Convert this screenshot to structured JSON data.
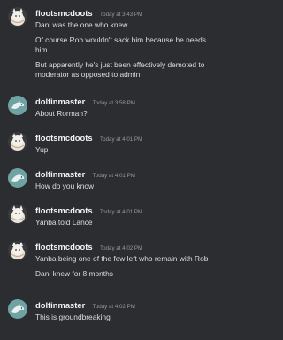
{
  "messages": [
    {
      "author": "flootsmcdoots",
      "avatar": "cat-avatar",
      "timestamp": "Today at 3:43 PM",
      "lines": [
        "Dani was the one who knew",
        "Of course Rob wouldn't sack him because he needs him",
        "But apparently he's just been effectively demoted to moderator as opposed to admin"
      ]
    },
    {
      "author": "dolfinmaster",
      "avatar": "dolphin-avatar",
      "timestamp": "Today at 3:58 PM",
      "lines": [
        "About Rorman?"
      ]
    },
    {
      "author": "flootsmcdoots",
      "avatar": "cat-avatar",
      "timestamp": "Today at 4:01 PM",
      "lines": [
        "Yup"
      ]
    },
    {
      "author": "dolfinmaster",
      "avatar": "dolphin-avatar",
      "timestamp": "Today at 4:01 PM",
      "lines": [
        "How do you know"
      ]
    },
    {
      "author": "flootsmcdoots",
      "avatar": "cat-avatar",
      "timestamp": "Today at 4:01 PM",
      "lines": [
        "Yanba told Lance"
      ]
    },
    {
      "author": "flootsmcdoots",
      "avatar": "cat-avatar",
      "timestamp": "Today at 4:02 PM",
      "lines": [
        "Yanba being one of the few left who remain with Rob",
        "Dani knew for 8 months"
      ]
    },
    {
      "author": "dolfinmaster",
      "avatar": "dolphin-avatar",
      "timestamp": "Today at 4:02 PM",
      "lines": [
        "This is groundbreaking"
      ]
    }
  ],
  "colors": {
    "background": "#2b2d31",
    "username": "#f2f3f5",
    "timestamp": "#949ba4",
    "message_text": "#dbdee1"
  }
}
